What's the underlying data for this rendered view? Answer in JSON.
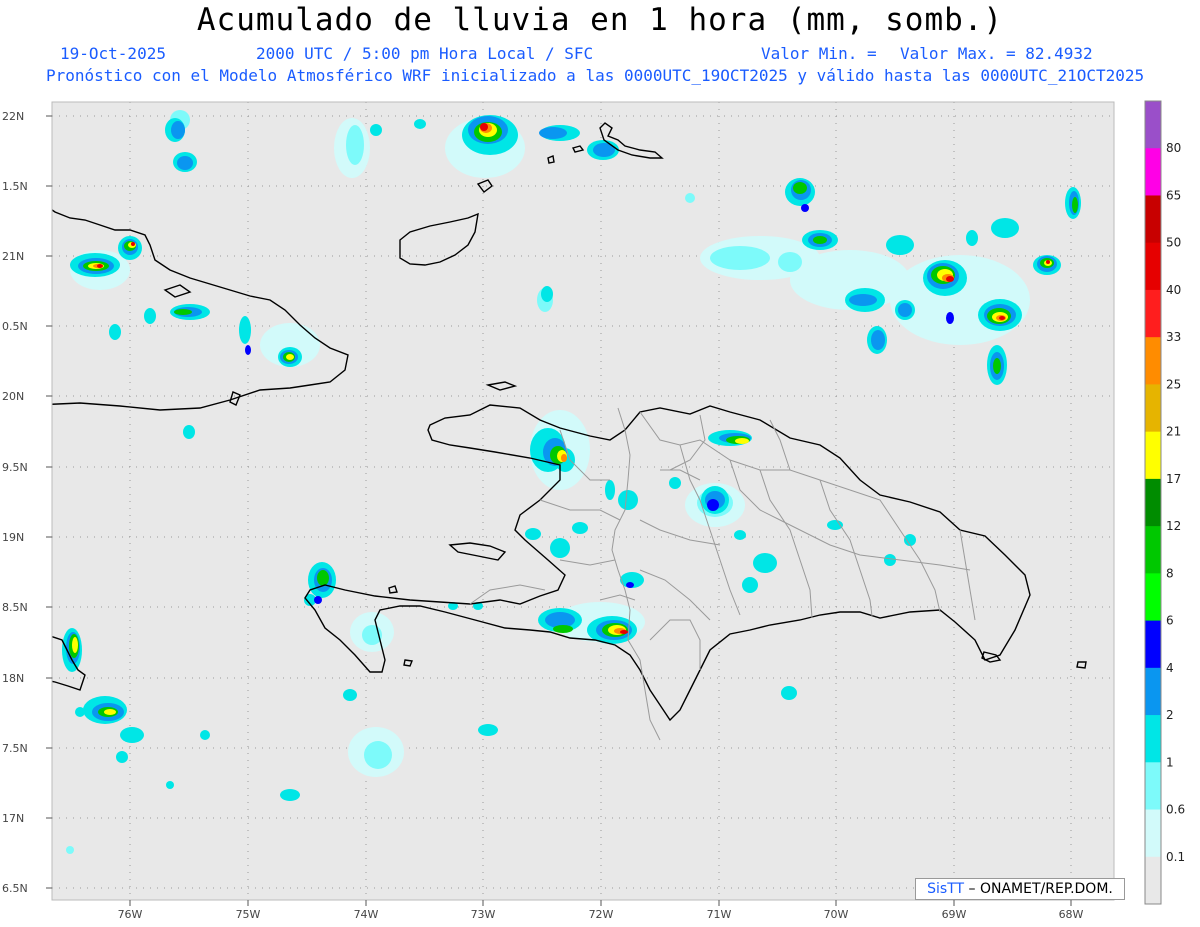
{
  "header": {
    "title": "Acumulado de lluvia en 1 hora (mm, somb.)",
    "date": "19-Oct-2025",
    "time": "2000 UTC / 5:00 pm Hora Local / SFC",
    "min_label": "Valor Min. =",
    "max_label": "Valor Max. = 82.4932",
    "model_line": "Pronóstico con el Modelo Atmosférico WRF inicializado a las 0000UTC_19OCT2025 y válido hasta las  0000UTC_21OCT2025"
  },
  "axes": {
    "lat_labels": [
      "22N",
      "1.5N",
      "21N",
      "0.5N",
      "20N",
      "9.5N",
      "19N",
      "8.5N",
      "18N",
      "7.5N",
      "17N",
      "6.5N"
    ],
    "lon_labels": [
      "76W",
      "75W",
      "74W",
      "73W",
      "72W",
      "71W",
      "70W",
      "69W",
      "68W"
    ]
  },
  "colorbar": {
    "labels": [
      "80",
      "65",
      "50",
      "40",
      "33",
      "25",
      "21",
      "17",
      "12",
      "8",
      "6",
      "4",
      "2",
      "1",
      "0.6",
      "0.1"
    ],
    "colors": [
      "#9a4fc9",
      "#ff00e6",
      "#c80000",
      "#e60000",
      "#ff1e1e",
      "#ff8c00",
      "#e6b400",
      "#ffff00",
      "#008c00",
      "#00c800",
      "#00ff00",
      "#0000ff",
      "#0a96f0",
      "#00e6e6",
      "#7dfafa",
      "#d2fafa",
      "#e8e8e8"
    ]
  },
  "attribution": {
    "logo": "SisTT",
    "text": "– ONAMET/REP.DOM."
  },
  "colors": {
    "map_background": "#e8e8e8",
    "coastline": "#000000",
    "province_border": "#9a9a9a",
    "header_blue": "#1a5cff"
  }
}
